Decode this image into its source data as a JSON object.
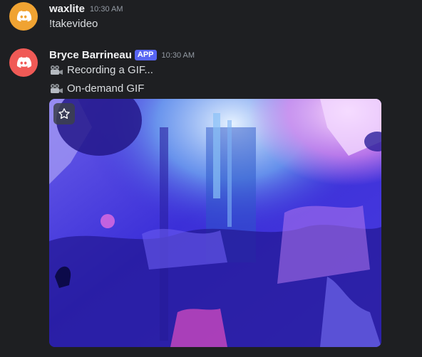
{
  "messages": [
    {
      "username": "waxlite",
      "timestamp": "10:30 AM",
      "lines": [
        "!takevideo"
      ],
      "avatar_color": "#f0a332",
      "avatar_icon": "discord-logo-icon"
    },
    {
      "username": "Bryce Barrineau",
      "badge": "APP",
      "timestamp": "10:30 AM",
      "lines": [
        "Recording a GIF...",
        "On-demand GIF"
      ],
      "line_icon": "movie-camera-icon",
      "avatar_color": "#f05a56",
      "avatar_icon": "discord-logo-icon",
      "attachment": {
        "type": "gif",
        "favorite_icon": "star-icon"
      }
    }
  ],
  "colors": {
    "background": "#1e1f22",
    "badge": "#5865f2",
    "username": "#f2f3f5",
    "text": "#dbdee1",
    "timestamp": "#949ba4"
  }
}
